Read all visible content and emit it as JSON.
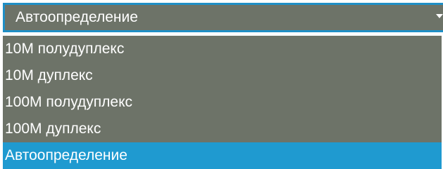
{
  "select": {
    "value": "Автоопределение",
    "icon": "chevron-down-icon"
  },
  "options": [
    {
      "label": "10M полудуплекс",
      "selected": false
    },
    {
      "label": "10M дуплекс",
      "selected": false
    },
    {
      "label": "100M полудуплекс",
      "selected": false
    },
    {
      "label": "100M дуплекс",
      "selected": false
    },
    {
      "label": "Автоопределение",
      "selected": true
    }
  ],
  "colors": {
    "item_background": "#6d7368",
    "accent": "#1f9ad0",
    "text": "#ffffff"
  }
}
